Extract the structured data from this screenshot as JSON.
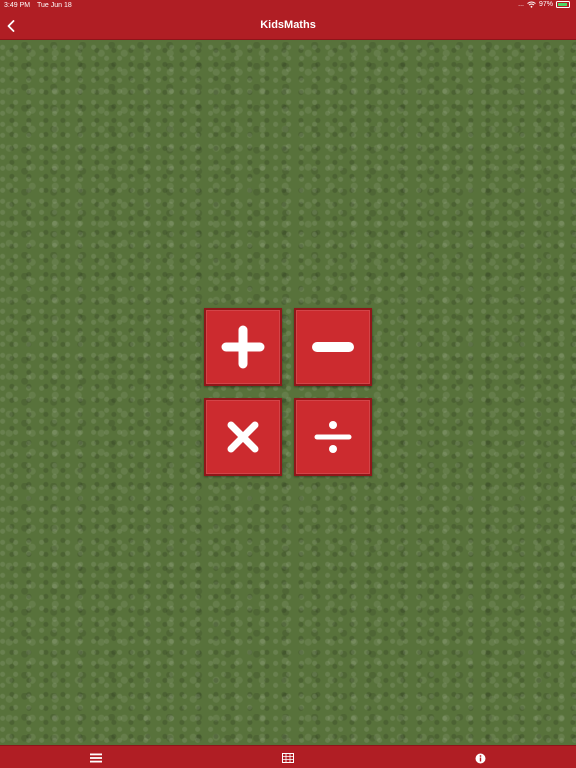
{
  "status_bar": {
    "time": "3:49 PM",
    "date": "Tue Jun 18",
    "dots": "...",
    "battery_percent": "97%"
  },
  "nav_bar": {
    "title": "KidsMaths",
    "back_icon": "chevron-left-icon"
  },
  "operations": [
    {
      "name": "addition",
      "icon": "plus-icon"
    },
    {
      "name": "subtraction",
      "icon": "minus-icon"
    },
    {
      "name": "multiplication",
      "icon": "times-icon"
    },
    {
      "name": "division",
      "icon": "divide-icon"
    }
  ],
  "tab_bar": {
    "items": [
      {
        "icon": "menu-icon"
      },
      {
        "icon": "table-icon"
      },
      {
        "icon": "info-icon"
      }
    ]
  },
  "colors": {
    "accent_red": "#b01e24",
    "button_red": "#cc2b2f",
    "background_green": "#58723b"
  }
}
